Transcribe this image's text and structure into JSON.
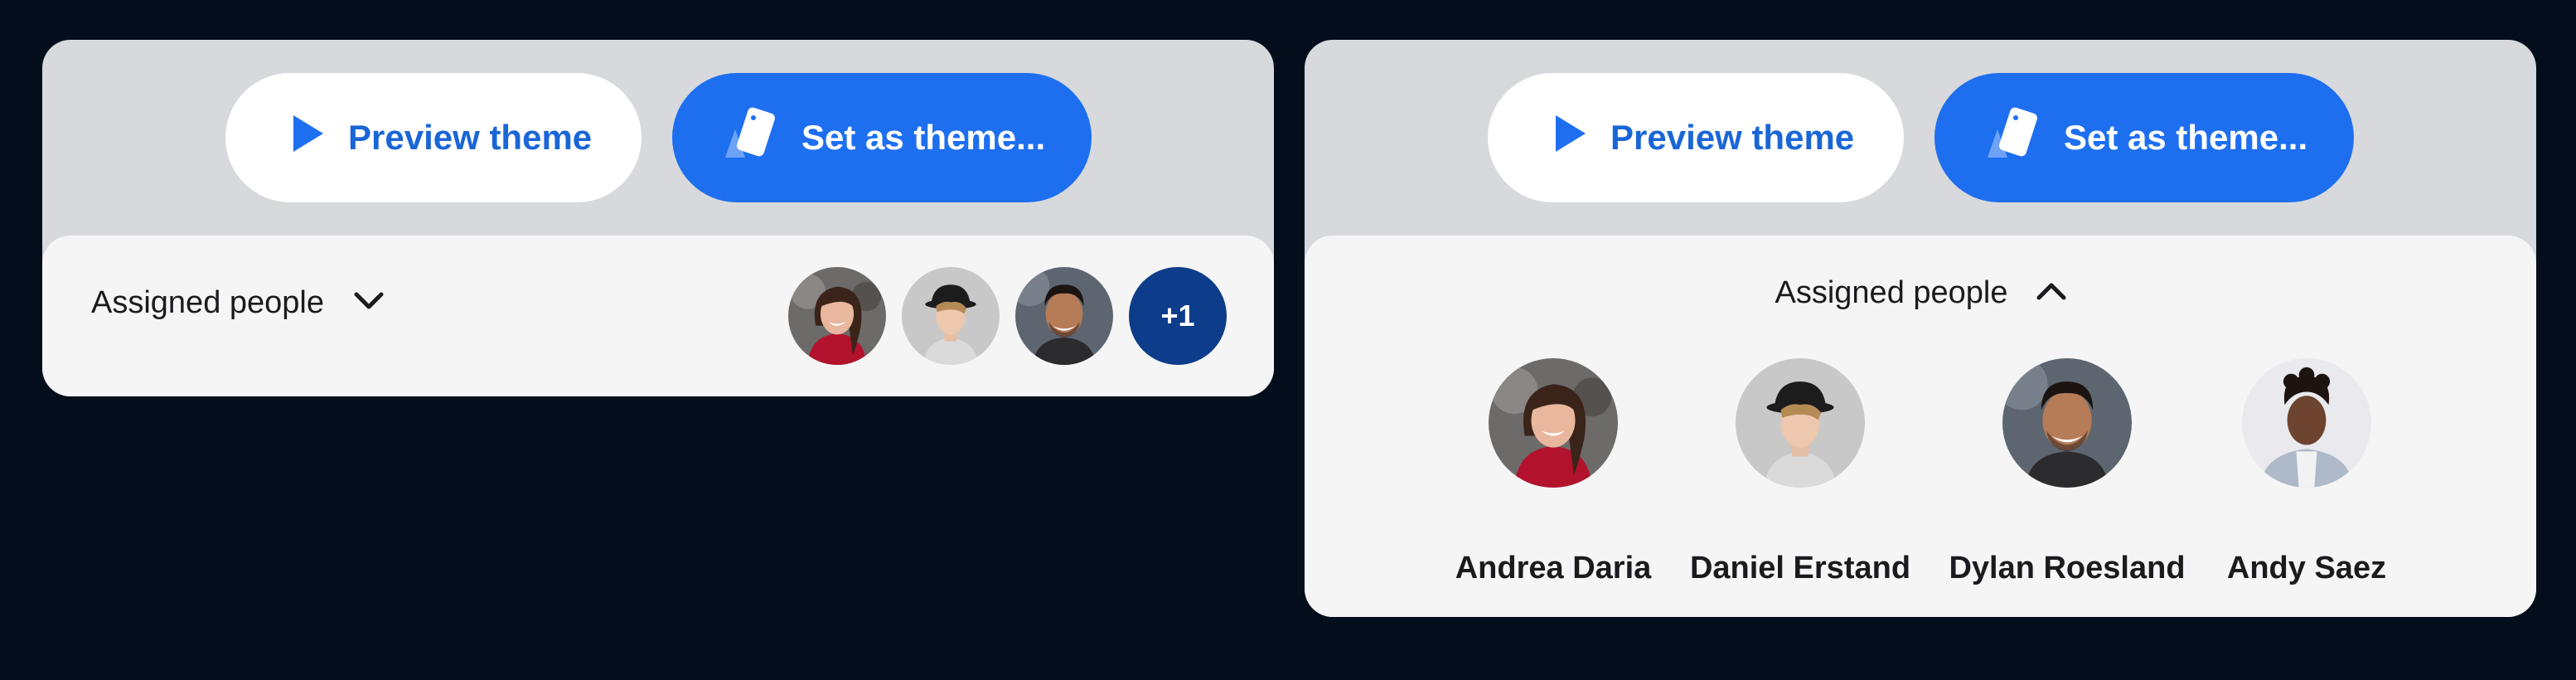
{
  "left_card": {
    "preview_label": "Preview theme",
    "set_label": "Set as theme...",
    "section_label": "Assigned people",
    "more_count": "+1"
  },
  "right_card": {
    "preview_label": "Preview theme",
    "set_label": "Set as theme...",
    "section_label": "Assigned people",
    "people": [
      {
        "name": "Andrea Daria"
      },
      {
        "name": "Daniel Erstand"
      },
      {
        "name": "Dylan Roesland"
      },
      {
        "name": "Andy Saez"
      }
    ]
  },
  "icons": {
    "play": "play-icon",
    "theme": "theme-cards-icon",
    "chevron_down": "chevron-down-icon",
    "chevron_up": "chevron-up-icon"
  },
  "colors": {
    "background": "#040d1c",
    "primary": "#1e6ff0",
    "primary_text": "#1a66d6",
    "avatar_more": "#0d3d8a"
  }
}
